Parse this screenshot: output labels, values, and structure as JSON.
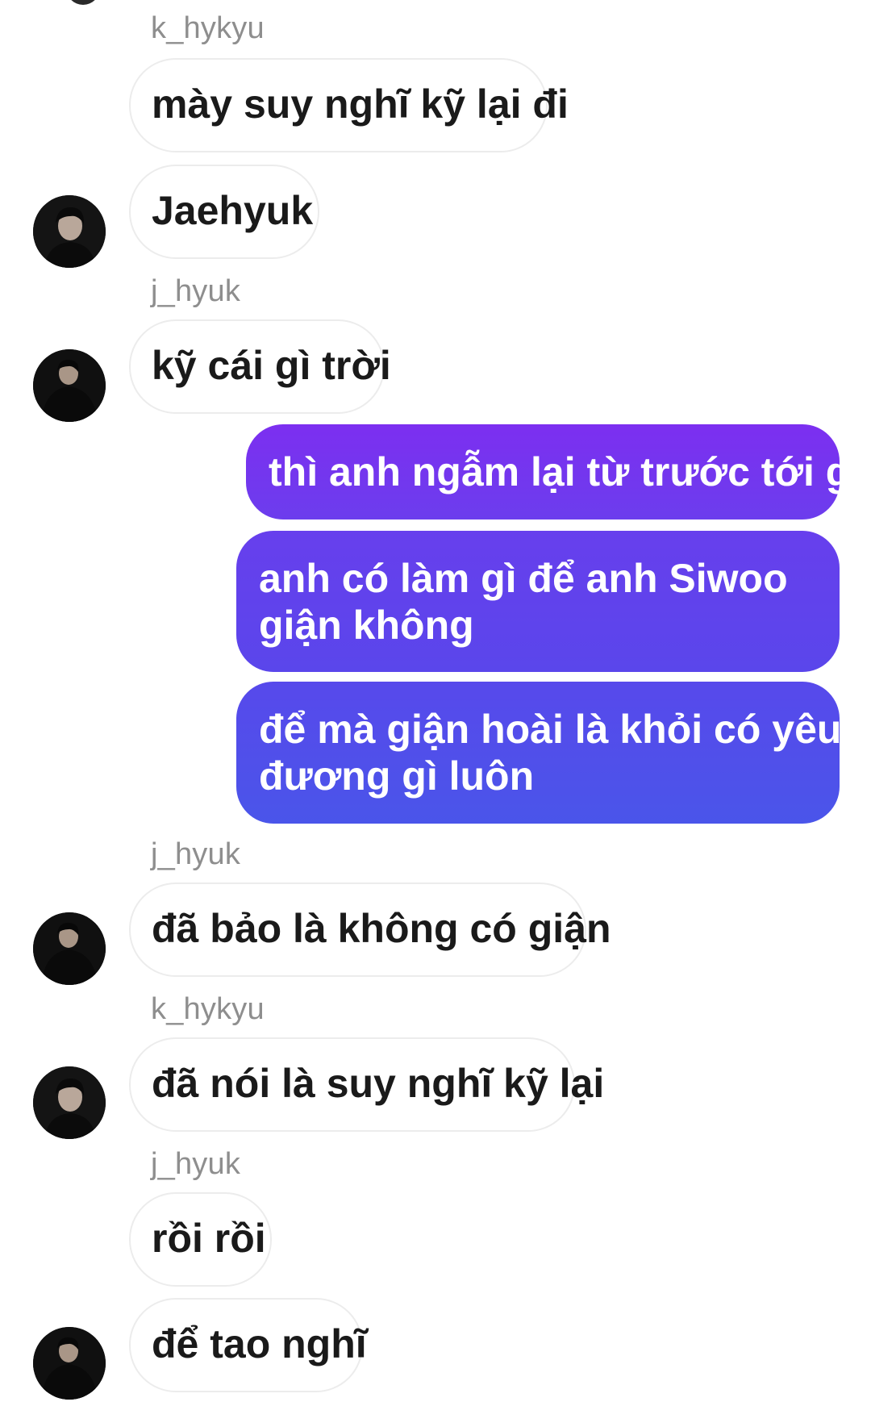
{
  "conversation": {
    "messages": [
      {
        "sender": "k_hykyu",
        "text": "mày suy nghĩ kỹ lại đi"
      },
      {
        "text": "Jaehyuk"
      },
      {
        "sender": "j_hyuk",
        "text": "kỹ cái gì trời"
      },
      {
        "text": "thì anh ngẫm lại từ trước tới giờ"
      },
      {
        "line1": "anh có làm gì để anh Siwoo",
        "line2": "giận không"
      },
      {
        "line1": "để mà giận hoài là khỏi có yêu",
        "line2": "đương gì luôn"
      },
      {
        "sender": "j_hyuk",
        "text": "đã bảo là không có giận"
      },
      {
        "sender": "k_hykyu",
        "text": "đã nói là suy nghĩ kỹ lại"
      },
      {
        "sender": "j_hyuk",
        "text": "rồi rồi"
      },
      {
        "text": "để tao nghĩ"
      }
    ]
  },
  "colors": {
    "outgoing_gradient_top": "#7c2ff0",
    "outgoing_gradient_bottom": "#4a55ea",
    "incoming_border": "#ececec",
    "sender_name": "#8e8e8e"
  }
}
